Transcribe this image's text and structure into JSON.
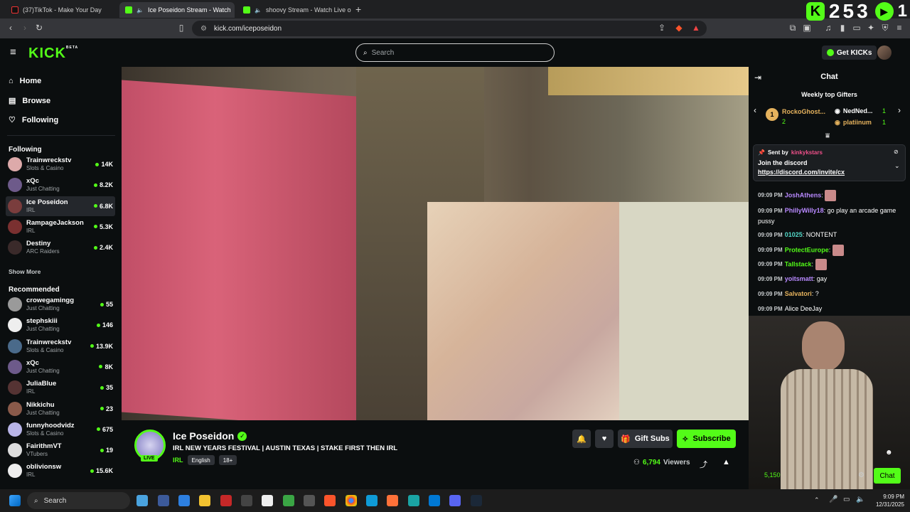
{
  "browser": {
    "tabs": [
      {
        "title": "(37)TikTok - Make Your Day",
        "active": false
      },
      {
        "title": "Ice Poseidon Stream - Watch",
        "active": true
      },
      {
        "title": "shoovy Stream - Watch Live on K",
        "active": false
      }
    ],
    "url": "kick.com/iceposeidon",
    "overlay_count": "253",
    "overlay_extra": "1"
  },
  "header": {
    "logo": "KICK",
    "logo_badge": "BETA",
    "search_placeholder": "Search",
    "get_kicks": "Get KICKs"
  },
  "sidebar": {
    "nav": [
      {
        "label": "Home",
        "icon": "home-icon"
      },
      {
        "label": "Browse",
        "icon": "browse-icon"
      },
      {
        "label": "Following",
        "icon": "heart-icon"
      }
    ],
    "following_title": "Following",
    "following": [
      {
        "name": "Trainwreckstv",
        "category": "Slots & Casino",
        "viewers": "14K"
      },
      {
        "name": "xQc",
        "category": "Just Chatting",
        "viewers": "8.2K"
      },
      {
        "name": "Ice Poseidon",
        "category": "IRL",
        "viewers": "6.8K"
      },
      {
        "name": "RampageJackson",
        "category": "IRL",
        "viewers": "5.3K"
      },
      {
        "name": "Destiny",
        "category": "ARC Raiders",
        "viewers": "2.4K"
      }
    ],
    "show_more": "Show More",
    "recommended_title": "Recommended",
    "recommended": [
      {
        "name": "crowegamingg",
        "category": "Just Chatting",
        "viewers": "55"
      },
      {
        "name": "stephskiii",
        "category": "Just Chatting",
        "viewers": "146"
      },
      {
        "name": "Trainwreckstv",
        "category": "Slots & Casino",
        "viewers": "13.9K"
      },
      {
        "name": "xQc",
        "category": "Just Chatting",
        "viewers": "8K"
      },
      {
        "name": "JuliaBlue",
        "category": "IRL",
        "viewers": "35"
      },
      {
        "name": "Nikkichu",
        "category": "Just Chatting",
        "viewers": "23"
      },
      {
        "name": "funnyhoodvidz",
        "category": "Slots & Casino",
        "viewers": "675"
      },
      {
        "name": "FairithmVT",
        "category": "VTubers",
        "viewers": "19"
      },
      {
        "name": "oblivionsw",
        "category": "IRL",
        "viewers": "15.6K"
      }
    ]
  },
  "stream": {
    "channel": "Ice Poseidon",
    "title": "IRL NEW YEARS FESTIVAL | AUSTIN TEXAS | STAKE FIRST THEN IRL",
    "category": "IRL",
    "tags": [
      "English",
      "18+"
    ],
    "live_badge": "LIVE",
    "gift_subs": "Gift Subs",
    "subscribe": "Subscribe",
    "viewers": "6,794",
    "viewers_label": "Viewers"
  },
  "chat": {
    "title": "Chat",
    "gifters_title": "Weekly top Gifters",
    "gifters": [
      {
        "name": "RockoGhost...",
        "count": "2",
        "rank": "1"
      },
      {
        "name": "NedNed...",
        "count": "1"
      },
      {
        "name": "platiinum",
        "count": "1"
      }
    ],
    "pinned": {
      "sent_by": "Sent by",
      "sender": "kinkykstars",
      "text": "Join the discord",
      "link": "https://discord.com/invite/cx"
    },
    "messages": [
      {
        "time": "09:09 PM",
        "user": "JoshAthens",
        "text": "",
        "color": "#b889ff",
        "sticker": true
      },
      {
        "time": "09:09 PM",
        "user": "PhillyWilly18",
        "text": "go play an arcade game pussy",
        "color": "#b889ff"
      },
      {
        "time": "09:09 PM",
        "user": "01025",
        "text": "NONTENT",
        "color": "#53d8c8"
      },
      {
        "time": "09:09 PM",
        "user": "ProtectEurope",
        "text": "",
        "color": "#53fc18",
        "sticker": true
      },
      {
        "time": "09:09 PM",
        "user": "Tallstack",
        "text": "",
        "color": "#53fc18",
        "sticker": true
      },
      {
        "time": "09:09 PM",
        "user": "yoitsmatt",
        "text": "gay",
        "color": "#b889ff"
      },
      {
        "time": "09:09 PM",
        "user": "Salvatori",
        "text": "?",
        "color": "#e5b25d"
      },
      {
        "time": "09:09 PM",
        "user": "",
        "text": "Alice DeeJay",
        "color": "#b889ff"
      }
    ],
    "send_label": "Chat",
    "balance": "5,150"
  },
  "taskbar": {
    "search": "Search",
    "time": "9:09 PM",
    "date": "12/31/2025"
  }
}
